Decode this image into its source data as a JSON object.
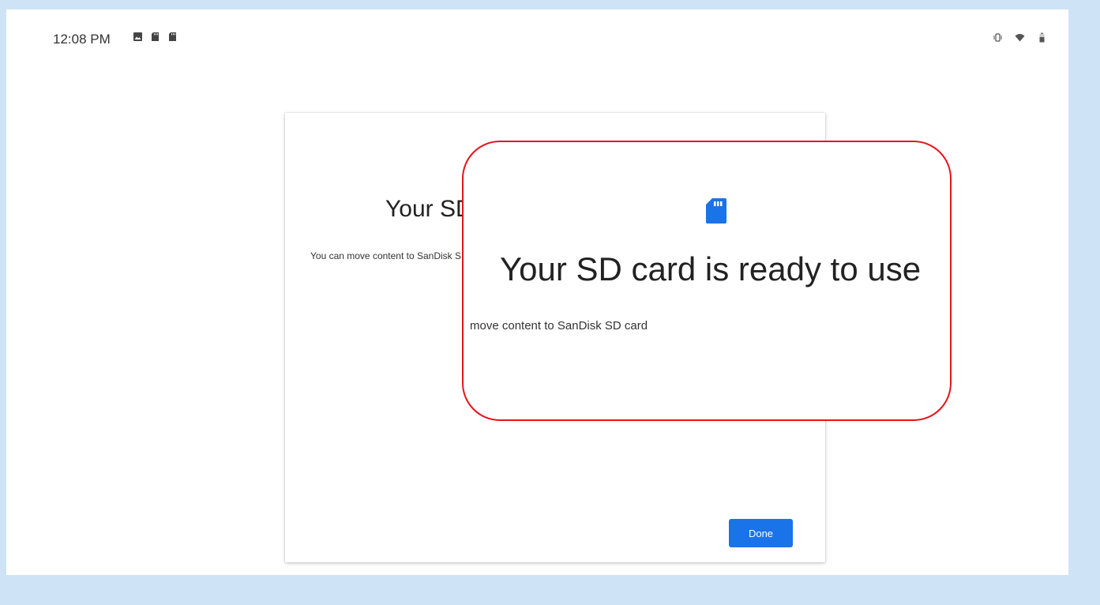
{
  "status_bar": {
    "time": "12:08 PM",
    "left_icons": [
      "image-icon",
      "sd-card-icon",
      "sd-card-icon"
    ],
    "right_icons": [
      "vibrate-icon",
      "wifi-icon",
      "battery-icon"
    ]
  },
  "dialog": {
    "title": "Your SD card is ready to use",
    "body": "You can move content to SanDisk SD card",
    "done_label": "Done"
  },
  "callout": {
    "icon": "sd-card-icon",
    "title": "Your SD card is ready to use",
    "body": "move content to SanDisk SD card"
  },
  "colors": {
    "accent": "#1a73e8",
    "callout_border": "#e5141b",
    "frame_background": "#cfe3f6"
  }
}
